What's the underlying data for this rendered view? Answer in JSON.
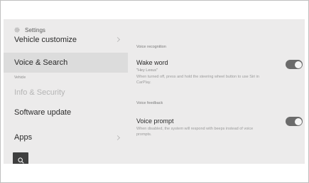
{
  "header": {
    "title": "Settings",
    "icon": "gear-icon"
  },
  "sidebar": {
    "items": [
      {
        "label": "Vehicle customize",
        "has_chevron": true
      },
      {
        "label": "Voice & Search",
        "selected": true
      },
      {
        "label": "Info & Security",
        "disabled": true
      },
      {
        "label": "Software update"
      },
      {
        "label": "Apps",
        "has_chevron": true
      }
    ],
    "caption": "Vehicle",
    "search_icon": "search-icon"
  },
  "content": {
    "voice_recognition": {
      "section_label": "Voice recognition",
      "title": "Wake word",
      "subtitle": "\"Hey Lexus\"",
      "description": "When turned off, press and hold the steering wheel button to use Siri in CarPlay.",
      "toggle_on": true
    },
    "voice_feedback": {
      "section_label": "Voice feedback",
      "title": "Voice prompt",
      "description": "When disabled, the system will respond with beeps instead of voice prompts.",
      "toggle_on": true
    }
  },
  "colors": {
    "screen_bg": "#ecebeb",
    "selected_row": "#dcdcdc",
    "toggle_track": "#6b6b6b",
    "search_button": "#3f3f3f"
  }
}
